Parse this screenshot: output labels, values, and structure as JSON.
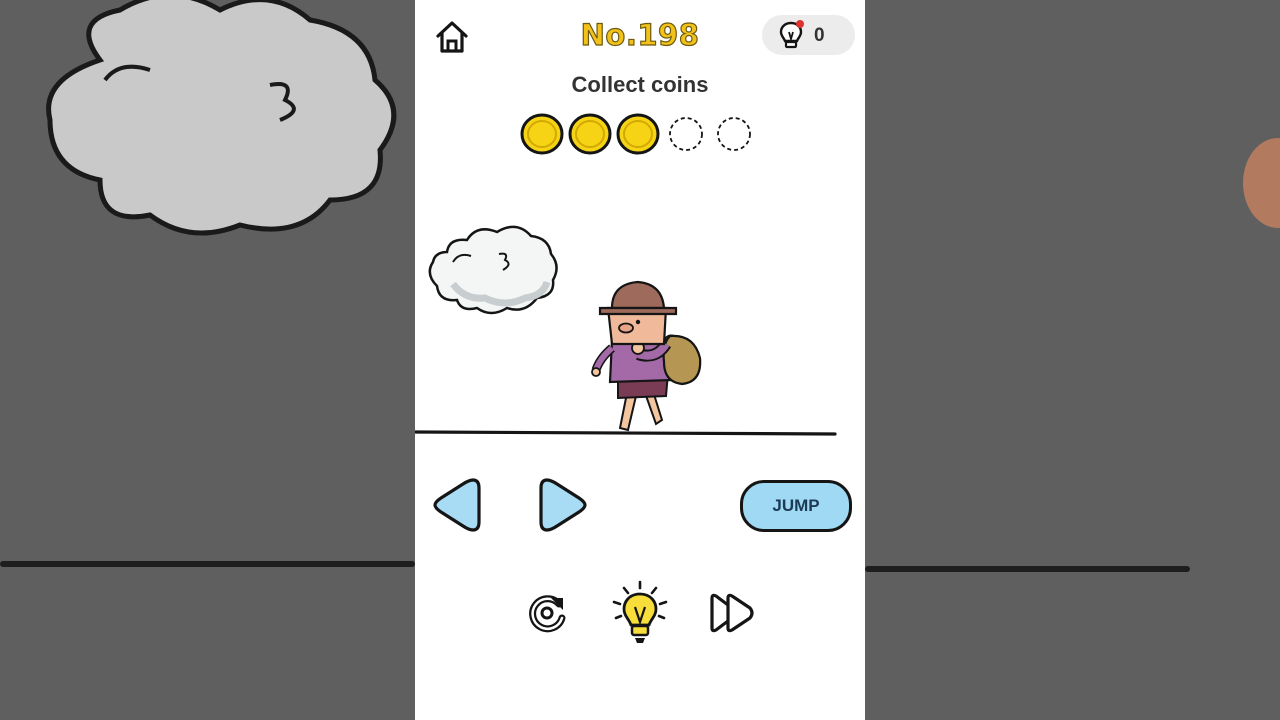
{
  "level": {
    "number_label": "No.198"
  },
  "hint": {
    "count": "0"
  },
  "objective": {
    "text": "Collect coins"
  },
  "coins": {
    "collected": 3,
    "total": 5
  },
  "controls": {
    "jump_label": "JUMP"
  },
  "colors": {
    "coin_fill": "#f7d315",
    "level_text": "#f2c21a",
    "jump_button": "#9fd9f4",
    "arrow_fill": "#a8dcf5",
    "character_shirt": "#a46aa8",
    "character_hat": "#9e6a5c",
    "sack": "#b59652"
  },
  "icons": {
    "home": "home-icon",
    "hint_small": "lightbulb-icon",
    "restart": "restart-icon",
    "hint_big": "lightbulb-icon",
    "skip": "fast-forward-icon"
  }
}
